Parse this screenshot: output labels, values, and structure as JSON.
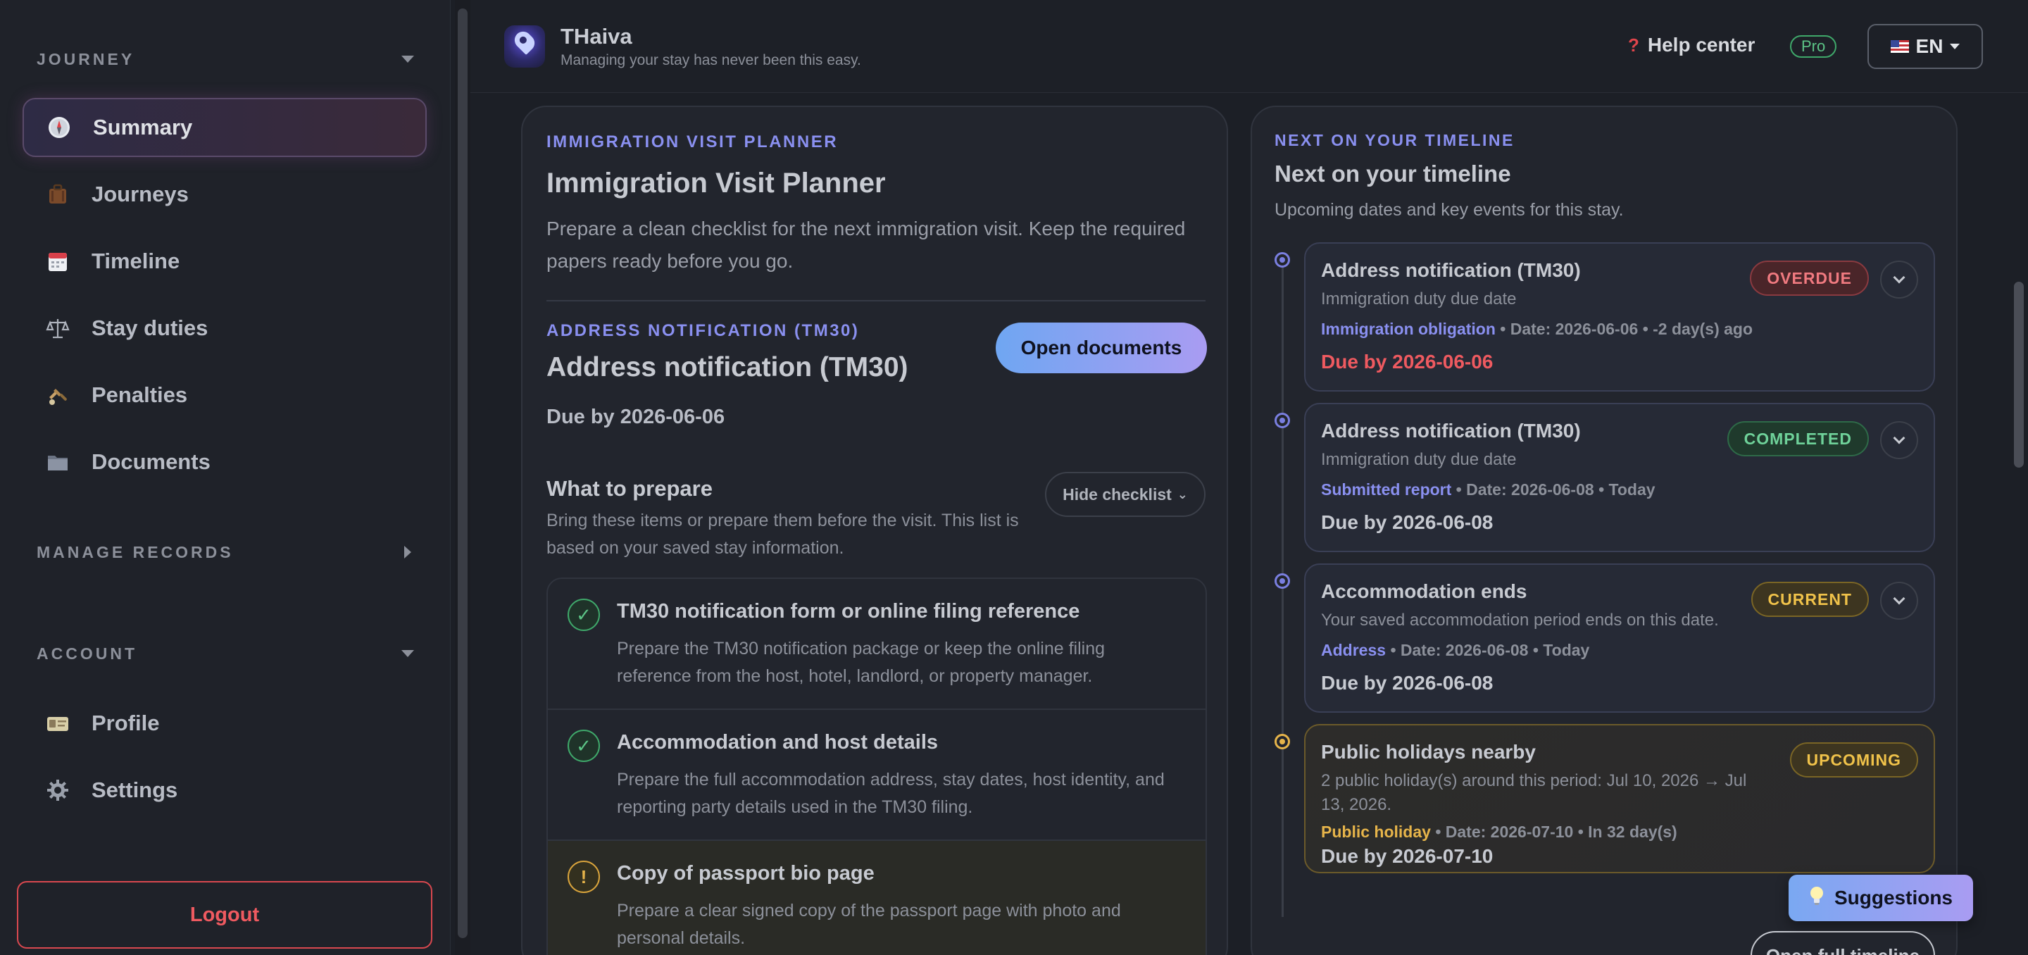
{
  "sidebar": {
    "journey_heading": "JOURNEY",
    "nav": [
      {
        "label": "Summary",
        "icon": "compass-icon"
      },
      {
        "label": "Journeys",
        "icon": "luggage-icon"
      },
      {
        "label": "Timeline",
        "icon": "calendar-icon"
      },
      {
        "label": "Stay duties",
        "icon": "scales-icon"
      },
      {
        "label": "Penalties",
        "icon": "penalty-icon"
      },
      {
        "label": "Documents",
        "icon": "folder-icon"
      }
    ],
    "manage_heading": "MANAGE RECORDS",
    "account_heading": "ACCOUNT",
    "account_nav": [
      {
        "label": "Profile",
        "icon": "id-card-icon"
      },
      {
        "label": "Settings",
        "icon": "gear-icon"
      }
    ],
    "logout_label": "Logout"
  },
  "header": {
    "brand": "THaiva",
    "tagline": "Managing your stay has never been this easy.",
    "help": "Help center",
    "plan": "Pro",
    "language": "EN"
  },
  "planner": {
    "eyebrow": "IMMIGRATION VISIT PLANNER",
    "title": "Immigration Visit Planner",
    "lead": "Prepare a clean checklist for the next immigration visit. Keep the required papers ready before you go.",
    "task_eyebrow": "ADDRESS NOTIFICATION (TM30)",
    "task_title": "Address notification (TM30)",
    "open_docs": "Open documents",
    "due": "Due by 2026-06-06",
    "prepare_title": "What to prepare",
    "hide_checklist": "Hide checklist",
    "prepare_sub": "Bring these items or prepare them before the visit. This list is based on your saved stay information.",
    "checklist": [
      {
        "title": "TM30 notification form or online filing reference",
        "desc": "Prepare the TM30 notification package or keep the online filing reference from the host, hotel, landlord, or property manager.",
        "status": "done",
        "mark": "✓"
      },
      {
        "title": "Accommodation and host details",
        "desc": "Prepare the full accommodation address, stay dates, host identity, and reporting party details used in the TM30 filing.",
        "status": "done",
        "mark": "✓"
      },
      {
        "title": "Copy of passport bio page",
        "desc": "Prepare a clear signed copy of the passport page with photo and personal details.",
        "status": "warning",
        "mark": "!"
      }
    ]
  },
  "timeline": {
    "eyebrow": "NEXT ON YOUR TIMELINE",
    "title": "Next on your timeline",
    "sub": "Upcoming dates and key events for this stay.",
    "events": [
      {
        "title": "Address notification (TM30)",
        "sub": "Immigration duty due date",
        "category": "Immigration obligation",
        "date": "Date: 2026-06-06",
        "rel": "-2 day(s) ago",
        "due": "Due by 2026-06-06",
        "badge": "OVERDUE"
      },
      {
        "title": "Address notification (TM30)",
        "sub": "Immigration duty due date",
        "category": "Submitted report",
        "date": "Date: 2026-06-08",
        "rel": "Today",
        "due": "Due by 2026-06-08",
        "badge": "COMPLETED"
      },
      {
        "title": "Accommodation ends",
        "sub": "Your saved accommodation period ends on this date.",
        "category": "Address",
        "date": "Date: 2026-06-08",
        "rel": "Today",
        "due": "Due by 2026-06-08",
        "badge": "CURRENT"
      },
      {
        "title": "Public holidays nearby",
        "sub": "2 public holiday(s) around this period: Jul 10, 2026 → Jul 13, 2026.",
        "category": "Public holiday",
        "date": "Date: 2026-07-10",
        "rel": "In 32 day(s)",
        "due": "Due by 2026-07-10",
        "badge": "UPCOMING"
      }
    ],
    "full_timeline": "Open full timeline"
  },
  "suggestions": "Suggestions",
  "sep": "•"
}
